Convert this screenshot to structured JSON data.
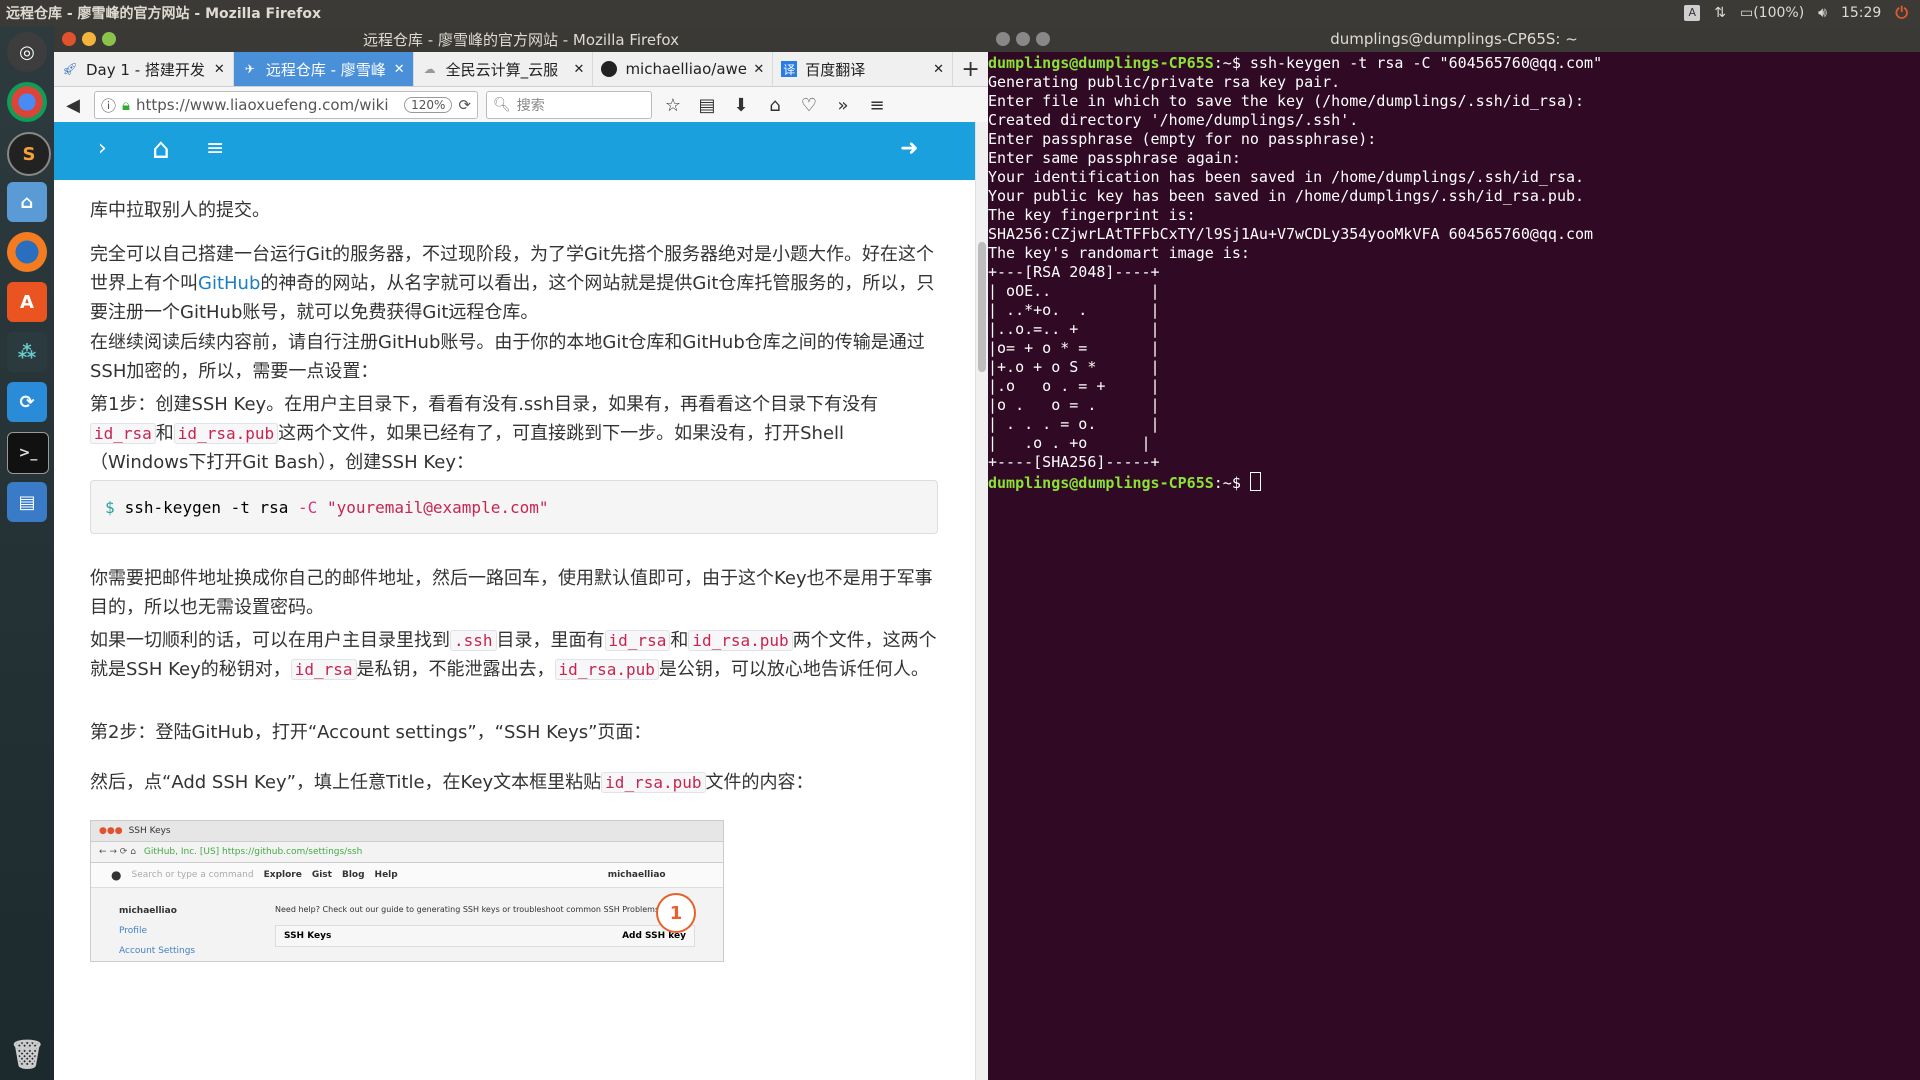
{
  "topbar": {
    "title": "远程仓库 - 廖雪峰的官方网站 - Mozilla Firefox",
    "battery": "(100%)",
    "clock": "15:29",
    "keyboard": "A"
  },
  "firefox": {
    "window_title": "远程仓库 - 廖雪峰的官方网站 - Mozilla Firefox",
    "tabs": [
      {
        "label": "Day 1 - 搭建开发",
        "icon": "rocket-icon"
      },
      {
        "label": "远程仓库 - 廖雪峰",
        "icon": "liao-icon"
      },
      {
        "label": "全民云计算_云服",
        "icon": "cloud-icon"
      },
      {
        "label": "michaelliao/awe",
        "icon": "github-icon"
      },
      {
        "label": "百度翻译",
        "icon": "translate-icon"
      }
    ],
    "translate_glyph": "译",
    "url": "https://www.liaoxuefeng.com/wiki",
    "zoom": "120%",
    "search_placeholder": "搜索"
  },
  "article": {
    "p0": "库中拉取别人的提交。",
    "p1a": "完全可以自己搭建一台运行Git的服务器，不过现阶段，为了学Git先搭个服务器绝对是小题大作。好在这个世界上有个叫",
    "p1link": "GitHub",
    "p1b": "的神奇的网站，从名字就可以看出，这个网站就是提供Git仓库托管服务的，所以，只要注册一个GitHub账号，就可以免费获得Git远程仓库。",
    "p2": "在继续阅读后续内容前，请自行注册GitHub账号。由于你的本地Git仓库和GitHub仓库之间的传输是通过SSH加密的，所以，需要一点设置：",
    "p3a": "第1步：创建SSH Key。在用户主目录下，看看有没有.ssh目录，如果有，再看看这个目录下有没有",
    "code_id_rsa": "id_rsa",
    "and": "和",
    "code_id_rsa_pub": "id_rsa.pub",
    "p3b": "这两个文件，如果已经有了，可直接跳到下一步。如果没有，打开Shell（Windows下打开Git Bash），创建SSH Key：",
    "cmd_prompt": "$",
    "cmd_main": "ssh-keygen -t rsa ",
    "cmd_flag": "-C",
    "cmd_str": "\"youremail@example.com\"",
    "p4": "你需要把邮件地址换成你自己的邮件地址，然后一路回车，使用默认值即可，由于这个Key也不是用于军事目的，所以也无需设置密码。",
    "p5a": "如果一切顺利的话，可以在用户主目录里找到",
    "code_ssh": ".ssh",
    "p5b": "目录，里面有",
    "p5c": "两个文件，这两个就是SSH Key的秘钥对，",
    "p5d": "是私钥，不能泄露出去，",
    "p5e": "是公钥，可以放心地告诉任何人。",
    "p6": "第2步：登陆GitHub，打开“Account settings”，“SSH Keys”页面：",
    "p7a": "然后，点“Add SSH Key”，填上任意Title，在Key文本框里粘贴",
    "p7b": "文件的内容："
  },
  "screenshot": {
    "tab": "SSH Keys",
    "url": "GitHub, Inc. [US] https://github.com/settings/ssh",
    "nav": [
      "Explore",
      "Gist",
      "Blog",
      "Help"
    ],
    "search": "Search or type a command",
    "user": "michaelliao",
    "side_user": "michaelliao",
    "side_items": [
      "Profile",
      "Account Settings"
    ],
    "help": "Need help? Check out our guide to generating SSH keys or troubleshoot common SSH Problems",
    "keys_title": "SSH Keys",
    "add_button": "Add SSH key",
    "badge": "1"
  },
  "terminal": {
    "window_title": "dumplings@dumplings-CP65S: ~",
    "prompt": "dumplings@dumplings-CP65S",
    "prompt_suffix": ":~$ ",
    "command": "ssh-keygen -t rsa -C \"604565760@qq.com\"",
    "output": [
      "Generating public/private rsa key pair.",
      "Enter file in which to save the key (/home/dumplings/.ssh/id_rsa):",
      "Created directory '/home/dumplings/.ssh'.",
      "Enter passphrase (empty for no passphrase):",
      "Enter same passphrase again:",
      "Your identification has been saved in /home/dumplings/.ssh/id_rsa.",
      "Your public key has been saved in /home/dumplings/.ssh/id_rsa.pub.",
      "The key fingerprint is:",
      "SHA256:CZjwrLAtTFFbCxTY/l9Sj1Au+V7wCDLy354yooMkVFA 604565760@qq.com",
      "The key's randomart image is:",
      "+---[RSA 2048]----+",
      "| oOE..           |",
      "| ..*+o.  .       |",
      "|..o.=.. +        |",
      "|o= + o * =       |",
      "|+.o + o S *      |",
      "|.o   o . = +     |",
      "|o .   o = .      |",
      "| . . . = o.      |",
      "|   .o . +o      |",
      "+----[SHA256]-----+"
    ]
  },
  "colors": {
    "site_blue": "#1aa0dc",
    "active_tab": "#4a90d9",
    "terminal_bg": "#300a24",
    "prompt_green": "#8ae234",
    "code_red": "#c7254e"
  }
}
